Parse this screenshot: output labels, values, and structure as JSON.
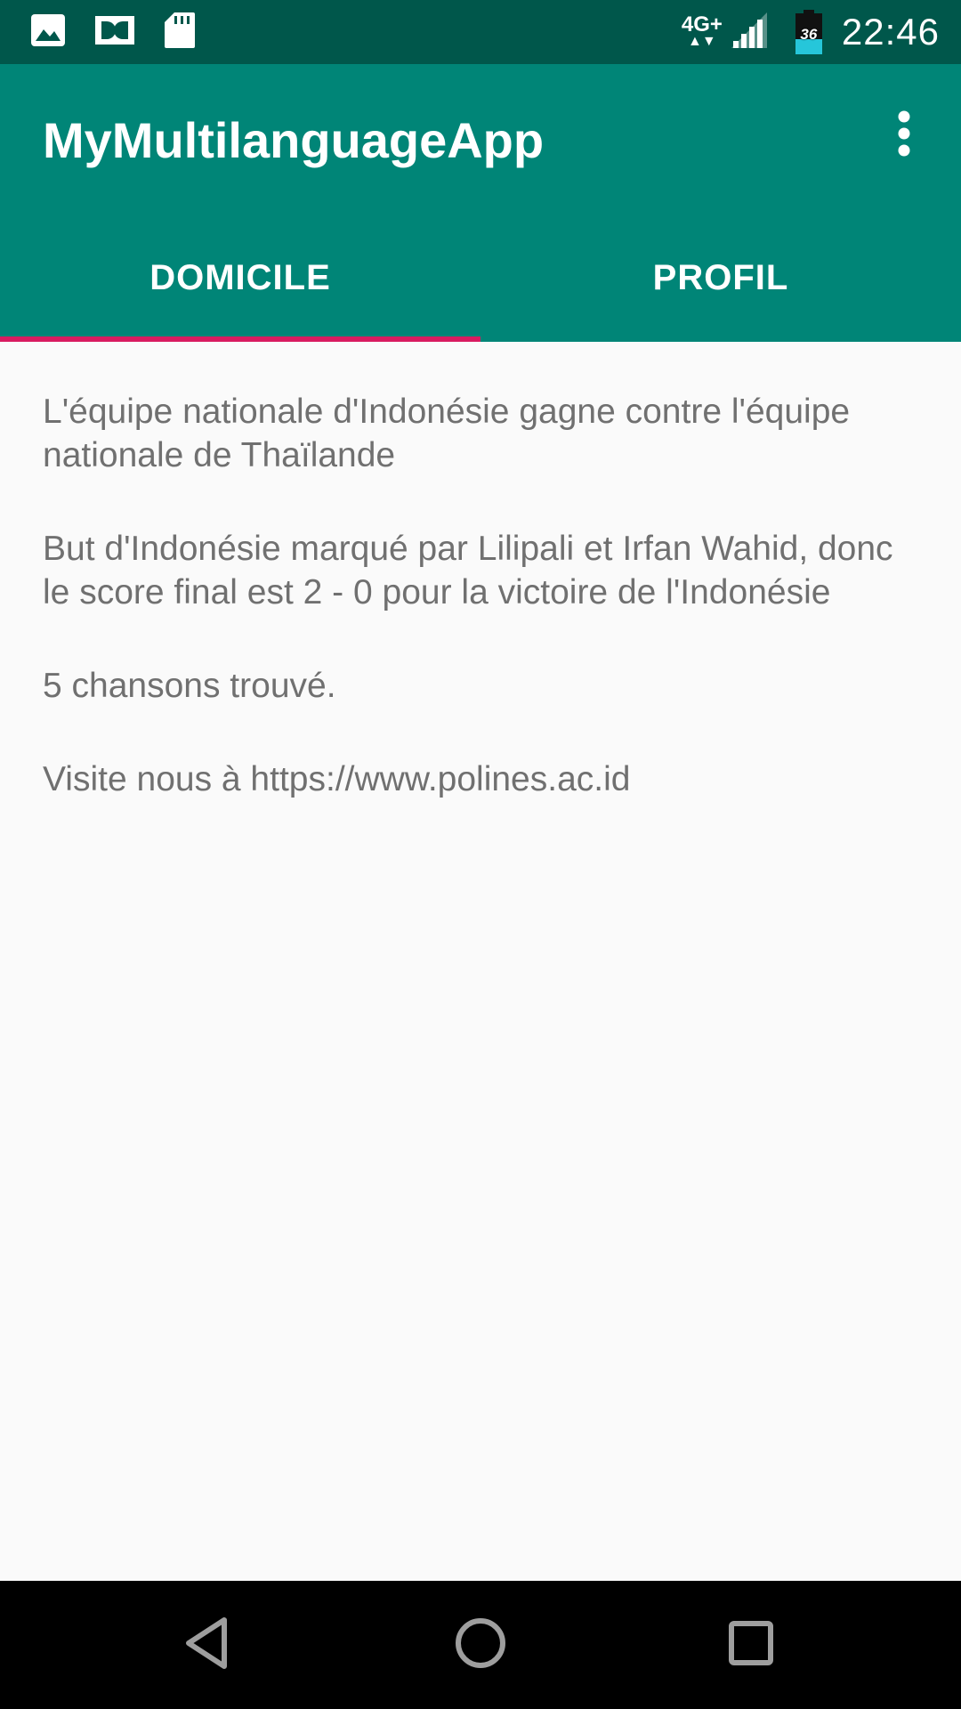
{
  "status_bar": {
    "network_type": "4G+",
    "battery_level": "36",
    "battery_fraction": 0.36,
    "time": "22:46",
    "icons": [
      "image-icon",
      "dolby-icon",
      "sd-card-icon",
      "network-arrows-icon",
      "signal-icon",
      "battery-icon"
    ]
  },
  "app_bar": {
    "title": "MyMultilanguageApp",
    "overflow_icon": "more-vert-icon"
  },
  "tabs": [
    {
      "label": "DOMICILE",
      "selected": true
    },
    {
      "label": "PROFIL",
      "selected": false
    }
  ],
  "content": {
    "paragraphs": [
      "L'équipe nationale d'Indonésie gagne contre l'équipe nationale de Thaïlande",
      "But d'Indonésie marqué par Lilipali et Irfan Wahid, donc le score final est 2 - 0 pour la victoire de l'Indonésie",
      "5 chansons trouvé.",
      "Visite nous à https://www.polines.ac.id"
    ]
  },
  "nav_bar": {
    "icons": [
      "back-icon",
      "home-icon",
      "recents-icon"
    ]
  },
  "colors": {
    "status_bar": "#00574b",
    "primary": "#008577",
    "accent": "#d81b60",
    "text_secondary": "#707070",
    "background": "#fafafa"
  }
}
